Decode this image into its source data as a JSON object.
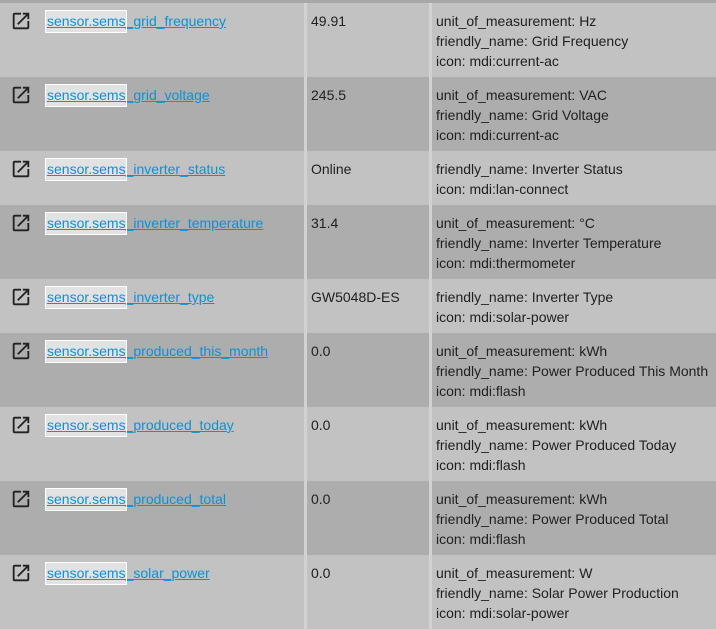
{
  "highlight_prefix": "sensor.sems",
  "rows": [
    {
      "suffix": "_grid_frequency",
      "state": "49.91",
      "attributes": [
        "unit_of_measurement: Hz",
        "friendly_name: Grid Frequency",
        "icon: mdi:current-ac"
      ]
    },
    {
      "suffix": "_grid_voltage",
      "state": "245.5",
      "attributes": [
        "unit_of_measurement: VAC",
        "friendly_name: Grid Voltage",
        "icon: mdi:current-ac"
      ]
    },
    {
      "suffix": "_inverter_status",
      "state": "Online",
      "attributes": [
        "friendly_name: Inverter Status",
        "icon: mdi:lan-connect"
      ]
    },
    {
      "suffix": "_inverter_temperature",
      "state": "31.4",
      "attributes": [
        "unit_of_measurement: °C",
        "friendly_name: Inverter Temperature",
        "icon: mdi:thermometer"
      ]
    },
    {
      "suffix": "_inverter_type",
      "state": "GW5048D-ES",
      "attributes": [
        "friendly_name: Inverter Type",
        "icon: mdi:solar-power"
      ]
    },
    {
      "suffix": "_produced_this_month",
      "state": "0.0",
      "attributes": [
        "unit_of_measurement: kWh",
        "friendly_name: Power Produced This Month",
        "icon: mdi:flash"
      ]
    },
    {
      "suffix": "_produced_today",
      "state": "0.0",
      "attributes": [
        "unit_of_measurement: kWh",
        "friendly_name: Power Produced Today",
        "icon: mdi:flash"
      ]
    },
    {
      "suffix": "_produced_total",
      "state": "0.0",
      "attributes": [
        "unit_of_measurement: kWh",
        "friendly_name: Power Produced Total",
        "icon: mdi:flash"
      ]
    },
    {
      "suffix": "_solar_power",
      "state": "0.0",
      "attributes": [
        "unit_of_measurement: W",
        "friendly_name: Solar Power Production",
        "icon: mdi:solar-power"
      ]
    }
  ]
}
